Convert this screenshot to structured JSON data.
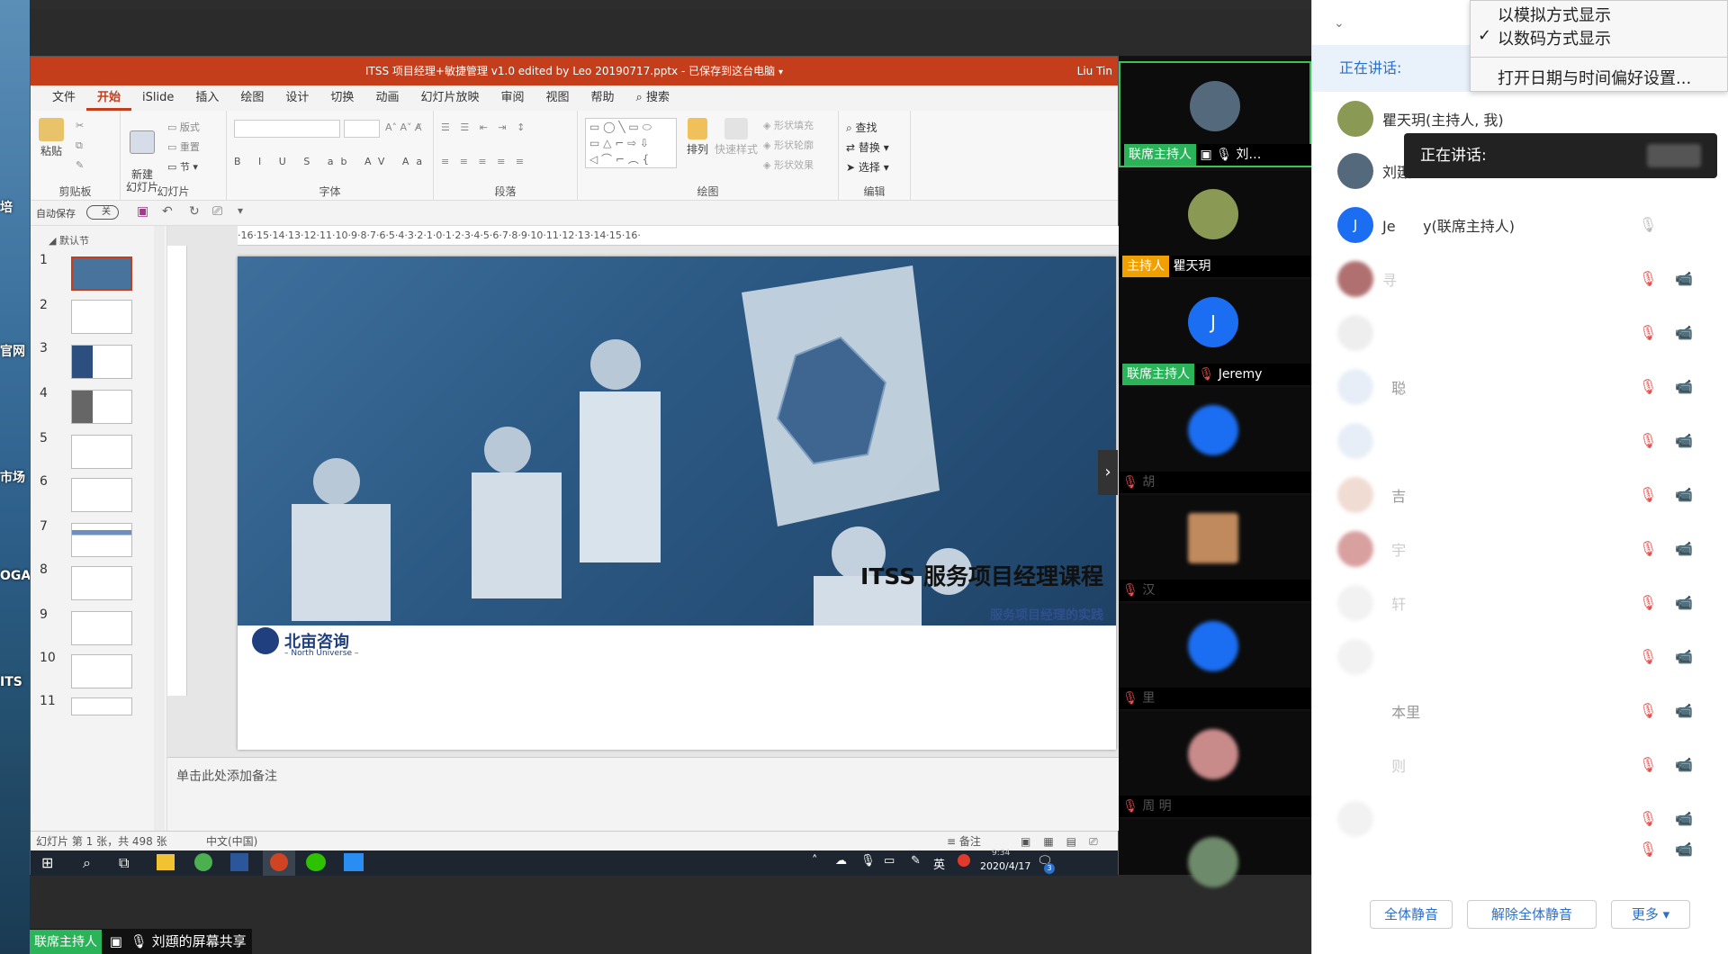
{
  "desktop": {
    "labels": [
      "培",
      "官网",
      "市场",
      "OGA",
      "ITS"
    ]
  },
  "ppt": {
    "title": "ITSS 项目经理+敏捷管理 v1.0 edited by Leo 20190717.pptx - 已保存到这台电脑",
    "user": "Liu Tin",
    "menu": [
      "文件",
      "开始",
      "iSlide",
      "插入",
      "绘图",
      "设计",
      "切换",
      "动画",
      "幻灯片放映",
      "审阅",
      "视图",
      "帮助"
    ],
    "search": "搜索",
    "groups": {
      "clipboard": "剪贴板",
      "slides": "幻灯片",
      "font": "字体",
      "paragraph": "段落",
      "drawing": "绘图",
      "editing": "编辑"
    },
    "buttons": {
      "paste": "粘贴",
      "new_slide": "新建\n幻灯片",
      "layout": "版式",
      "reset": "重置",
      "section": "节",
      "arrange": "排列",
      "quick_styles": "快速样式",
      "shape_fill": "形状填充",
      "shape_outline": "形状轮廓",
      "shape_effects": "形状效果",
      "find": "查找",
      "replace": "替换",
      "select": "选择"
    },
    "autosave": "自动保存",
    "autosave_state": "关",
    "section_label": "默认节",
    "thumb_numbers": [
      "1",
      "2",
      "3",
      "4",
      "5",
      "6",
      "7",
      "8",
      "9",
      "10",
      "11"
    ],
    "ruler_h": "·16·15·14·13·12·11·10·9·8·7·6·5·4·3·2·1·0·1·2·3·4·5·6·7·8·9·10·11·12·13·14·15·16·",
    "slide": {
      "title": "ITSS 服务项目经理课程",
      "subtitle": "服务项目经理的实践",
      "logo_cn": "北亩咨询",
      "logo_en": "– North Universe –"
    },
    "notes_placeholder": "单击此处添加备注",
    "status": {
      "slide_count": "幻灯片 第 1 张，共 498 张",
      "language": "中文(中国)",
      "notes": "备注"
    },
    "taskbar": {
      "time": "9:34",
      "date": "2020/4/17",
      "ime": "英",
      "notif_count": "3"
    }
  },
  "videos": [
    {
      "role": "联席主持人",
      "role_color": "#2bb35a",
      "name": "刘…"
    },
    {
      "role": "主持人",
      "role_color": "#f0a000",
      "name": "瞿天玥"
    },
    {
      "role": "联席主持人",
      "role_color": "#2bb35a",
      "name": "Jeremy",
      "initial": "J"
    },
    {
      "name": "胡"
    },
    {
      "name": "汉"
    },
    {
      "name": "里"
    },
    {
      "name": "周 明"
    },
    {
      "name": ""
    }
  ],
  "share_label": {
    "role": "联席主持人",
    "text": "刘頲的屏幕共享"
  },
  "panel": {
    "speaking_label": "正在讲话:",
    "participants": [
      {
        "name": "瞿天玥(主持人, 我)"
      },
      {
        "name": "刘頲"
      },
      {
        "name": "Je      y(联席主持人)",
        "initial": "J"
      },
      {
        "name": "寻"
      },
      {
        "name": ""
      },
      {
        "name": "  聪"
      },
      {
        "name": ""
      },
      {
        "name": "  吉"
      },
      {
        "name": "  宇"
      },
      {
        "name": "  轩"
      },
      {
        "name": ""
      },
      {
        "name": "  本里"
      },
      {
        "name": "  则"
      },
      {
        "name": ""
      },
      {
        "name": ""
      }
    ],
    "buttons": {
      "mute_all": "全体静音",
      "unmute_all": "解除全体静音",
      "more": "更多 ▾"
    }
  },
  "dropdown": {
    "items": [
      "以模拟方式显示",
      "以数码方式显示",
      "打开日期与时间偏好设置..."
    ],
    "checked_index": 1
  },
  "tooltip": {
    "text": "正在讲话:"
  }
}
